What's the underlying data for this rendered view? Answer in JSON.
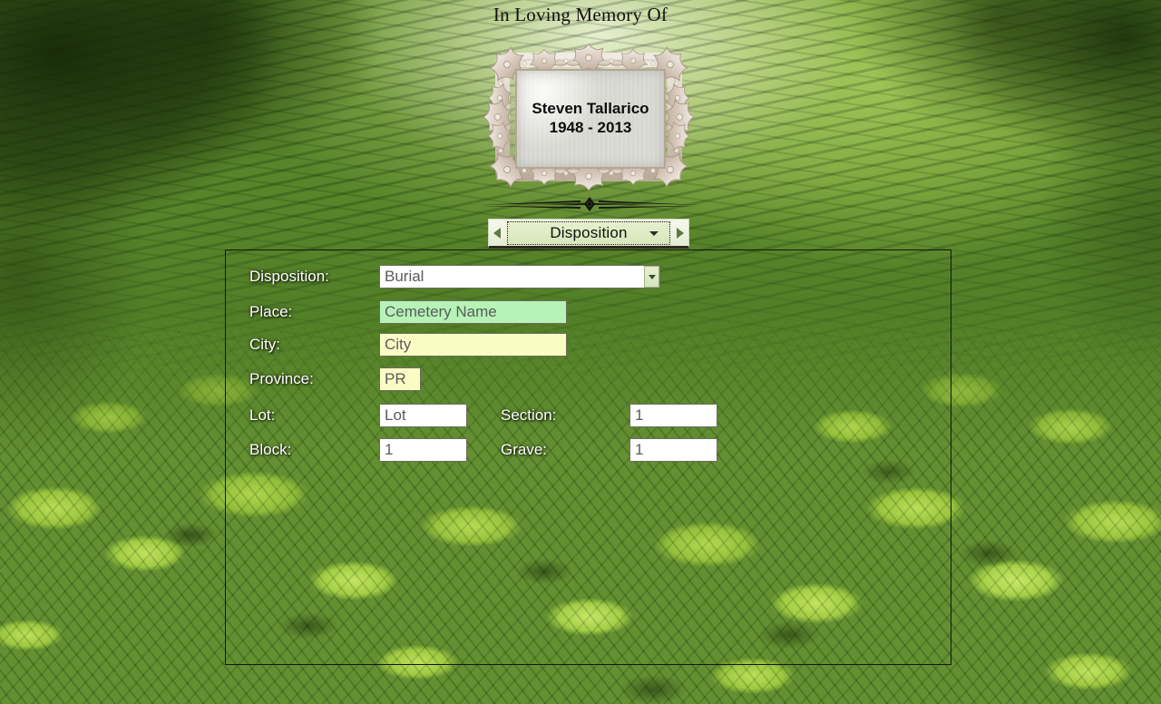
{
  "header": {
    "title": "In Loving Memory Of"
  },
  "plaque": {
    "name": "Steven Tallarico",
    "dates": "1948 - 2013"
  },
  "nav": {
    "prev_label": "◀",
    "next_label": "▶",
    "section_label": "Disposition"
  },
  "form": {
    "fields": [
      {
        "label": "Disposition:",
        "value": "Burial",
        "placeholder": "Disposition",
        "style": "white",
        "control": "combobox"
      },
      {
        "label": "Place:",
        "value": "Cemetery Name",
        "placeholder": "Cemetery Name",
        "style": "green",
        "control": "text"
      },
      {
        "label": "City:",
        "value": "City",
        "placeholder": "City",
        "style": "yellow",
        "control": "text"
      },
      {
        "label": "Province:",
        "value": "PR",
        "placeholder": "PR",
        "style": "yellow",
        "control": "text"
      },
      {
        "label": "Lot:",
        "value": "Lot",
        "placeholder": "Lot",
        "style": "white",
        "control": "text"
      },
      {
        "label": "Section:",
        "value": "1",
        "placeholder": "Section",
        "style": "white",
        "control": "text"
      },
      {
        "label": "Block:",
        "value": "1",
        "placeholder": "Block",
        "style": "white",
        "control": "text"
      },
      {
        "label": "Grave:",
        "value": "1",
        "placeholder": "Grave",
        "style": "white",
        "control": "text"
      }
    ]
  },
  "colors": {
    "field_green": "#b6f3b6",
    "field_yellow": "#fbfbc4",
    "field_white": "#ffffff",
    "label_text": "#ffffff",
    "value_text": "#585b5e",
    "panel_border": "#16160f",
    "nav_bar_bg": "#eef3e2"
  },
  "icons": {
    "prev": "triangle-left-icon",
    "next": "triangle-right-icon",
    "dropdown": "chevron-down-icon"
  }
}
